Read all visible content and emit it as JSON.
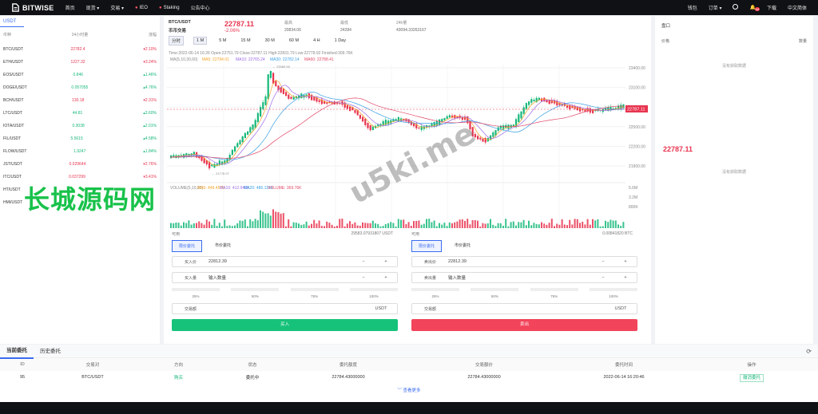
{
  "nav": {
    "brand": "BITWISE",
    "items": [
      "首页",
      "现货 ▾",
      "交易 ▾",
      "IEO",
      "Staking",
      "公告中心"
    ],
    "right": [
      "钱包",
      "订单 ▾",
      "",
      "下载",
      "中文简体"
    ],
    "badge": "12"
  },
  "market": {
    "tab": "USDT",
    "head": [
      "币种",
      "24小时量",
      "涨幅"
    ],
    "rows": [
      {
        "pair": "BTC/USDT",
        "price": "22782.4",
        "chg": "▾2.10%",
        "dir": "dn"
      },
      {
        "pair": "ETH/USDT",
        "price": "1227.32",
        "chg": "▾3.24%",
        "dir": "dn"
      },
      {
        "pair": "EOS/USDT",
        "price": "0.846",
        "chg": "▴1.46%",
        "dir": "up"
      },
      {
        "pair": "DOGE/USDT",
        "price": "0.057055",
        "chg": "▴4.76%",
        "dir": "up"
      },
      {
        "pair": "BCH/USDT",
        "price": "130.18",
        "chg": "▾2.31%",
        "dir": "dn"
      },
      {
        "pair": "LTC/USDT",
        "price": "44.81",
        "chg": "▴3.60%",
        "dir": "up"
      },
      {
        "pair": "IOTA/USDT",
        "price": "0.3038",
        "chg": "▴2.01%",
        "dir": "up"
      },
      {
        "pair": "FIL/USDT",
        "price": "5.5615",
        "chg": "▴4.58%",
        "dir": "up"
      },
      {
        "pair": "FLOW/USDT",
        "price": "1.9247",
        "chg": "▴1.84%",
        "dir": "up"
      },
      {
        "pair": "JST/USDT",
        "price": "0.029644",
        "chg": "▾2.76%",
        "dir": "dn"
      },
      {
        "pair": "ITC/USDT",
        "price": "0.037299",
        "chg": "▾3.41%",
        "dir": "dn"
      },
      {
        "pair": "HT/USDT",
        "price": "",
        "chg": "",
        "dir": "up"
      },
      {
        "pair": "HMI/USDT",
        "price": "",
        "chg": "",
        "dir": "up"
      }
    ]
  },
  "ticker": {
    "pair": "BTC/USDT",
    "type": "币币交易",
    "price": "22787.11",
    "change": "-2.06%",
    "high_lbl": "最高",
    "high": "20834.06",
    "low_lbl": "最低",
    "low": "24284",
    "vol_lbl": "24h量",
    "vol": "43094.33263167"
  },
  "tabs": [
    "分时",
    "1 M",
    "5 M",
    "15 M",
    "30 M",
    "60 M",
    "4 H",
    "1 Day"
  ],
  "chart_info": {
    "line1": "Time:2022-06-14 16:26    Open:22751.79    Close:22787.11    High:22831.79    Low:22778.92    Finished:309.76K",
    "ma_prefix": "MA(5,10,30,60)",
    "ma5": "MA5: 22794.01",
    "ma10": "MA10: 22765.24",
    "ma30": "MA30: 22782.14",
    "ma60": "MA60: 22788.41",
    "vol_prefix": "VOLUME(5,10,20)",
    "vma5": "MA5: 449.457K",
    "vma10": "MA10: 412.946K",
    "vma20": "MA20: 486.116K",
    "volume": "VOLUME: 369.76K",
    "yticks": [
      "23400.00",
      "23100.00",
      "22800.00",
      "22500.00",
      "22200.00",
      "21900.00"
    ],
    "vticks": [
      "5.6M",
      "3.2M",
      "800K"
    ],
    "xticks": [
      "12:57",
      "13:27",
      "13:57",
      "14:27",
      "14:57",
      "15:27",
      "15:57"
    ],
    "last": "22787.11",
    "hi_mark": "23360.55",
    "lo_mark": "21776.97"
  },
  "buy": {
    "title": "可用",
    "balance": "29583.07931807 USDT",
    "tab1": "限价委托",
    "tab2": "市价委托",
    "price_lbl": "买入价",
    "price": "22812.39",
    "amt_lbl": "买入量",
    "amt_ph": "输入数量",
    "pcts": [
      "25%",
      "50%",
      "75%",
      "100%"
    ],
    "total_lbl": "交易额",
    "unit": "USDT",
    "btn": "买入"
  },
  "sell": {
    "title": "可用",
    "balance": "0.00841820 BTC",
    "tab1": "限价委托",
    "tab2": "市价委托",
    "price_lbl": "卖出价",
    "price": "22812.39",
    "amt_lbl": "卖出量",
    "amt_ph": "输入数量",
    "pcts": [
      "25%",
      "50%",
      "75%",
      "100%"
    ],
    "total_lbl": "交易额",
    "unit": "USDT",
    "btn": "卖出"
  },
  "depth": {
    "title": "盘口",
    "col1": "价格",
    "col2": "数量",
    "empty": "没有获取数据",
    "price": "22787.11"
  },
  "orders": {
    "tab1": "当前委托",
    "tab2": "历史委托",
    "head": [
      "ID",
      "交易对",
      "方向",
      "状态",
      "委托额度",
      "交易额价",
      "委托时间",
      "操作"
    ],
    "row": [
      "95",
      "BTC/USDT",
      "购买",
      "委托中",
      "22784.43000000",
      "22784.43000000",
      "2022-06-14 16:20:46",
      "撤消委托"
    ],
    "more": "查看更多"
  },
  "watermark": {
    "cn": "长城源码网",
    "url": "u5ki.me"
  },
  "colors": {
    "up": "#16b87a",
    "down": "#e8344f",
    "accent": "#3b6cf0"
  }
}
